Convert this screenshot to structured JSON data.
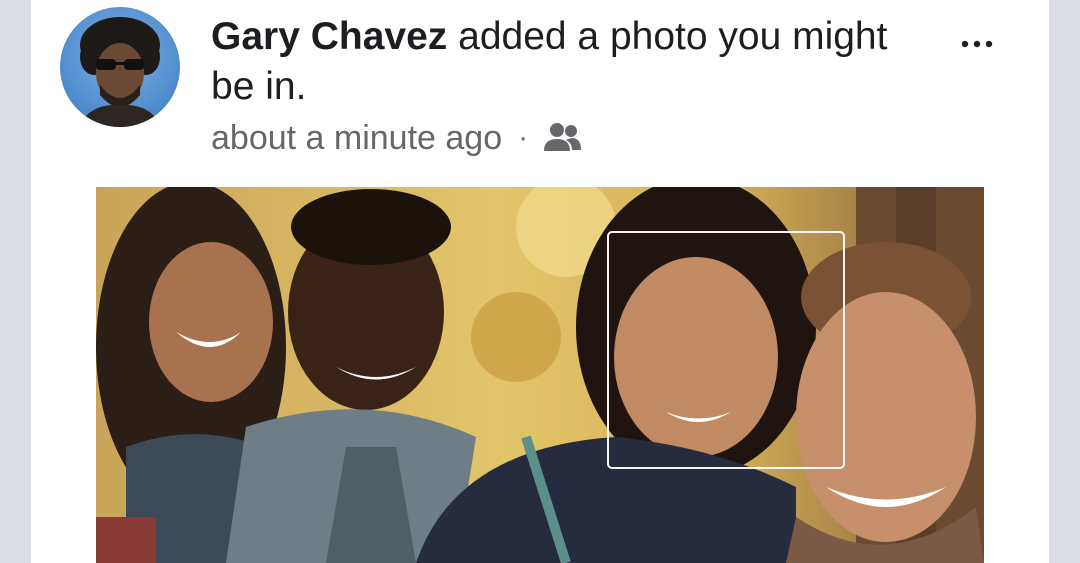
{
  "post": {
    "author_name": "Gary Chavez",
    "action_text": " added a photo you might be in.",
    "timestamp": "about a minute ago",
    "separator": "·",
    "audience_icon": "friends-icon",
    "more_icon": "more-options-icon"
  },
  "colors": {
    "background": "#dadde1",
    "card": "#ffffff",
    "text_primary": "#1c1e21",
    "text_secondary": "#65676b",
    "avatar_bg": "#5b95d4"
  }
}
